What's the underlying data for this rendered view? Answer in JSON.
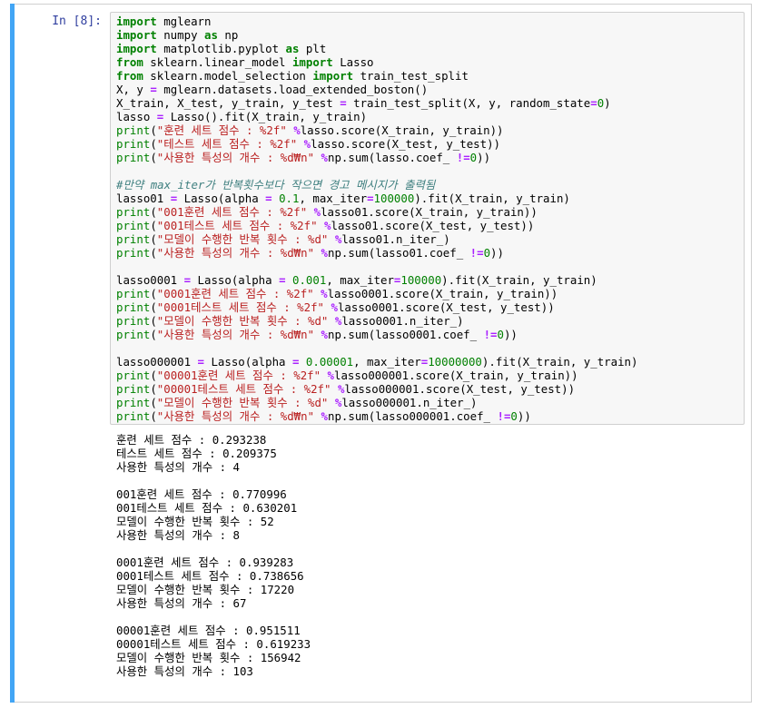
{
  "cell": {
    "prompt": "In [8]:",
    "code_lines": [
      [
        [
          "kw",
          "import"
        ],
        [
          "t",
          " mglearn"
        ]
      ],
      [
        [
          "kw",
          "import"
        ],
        [
          "t",
          " numpy "
        ],
        [
          "kw",
          "as"
        ],
        [
          "t",
          " np"
        ]
      ],
      [
        [
          "kw",
          "import"
        ],
        [
          "t",
          " matplotlib.pyplot "
        ],
        [
          "kw",
          "as"
        ],
        [
          "t",
          " plt"
        ]
      ],
      [
        [
          "kw",
          "from"
        ],
        [
          "t",
          " sklearn.linear_model "
        ],
        [
          "kw",
          "import"
        ],
        [
          "t",
          " Lasso"
        ]
      ],
      [
        [
          "kw",
          "from"
        ],
        [
          "t",
          " sklearn.model_selection "
        ],
        [
          "kw",
          "import"
        ],
        [
          "t",
          " train_test_split"
        ]
      ],
      [
        [
          "t",
          "X, y "
        ],
        [
          "op",
          "="
        ],
        [
          "t",
          " mglearn.datasets.load_extended_boston()"
        ]
      ],
      [
        [
          "t",
          "X_train, X_test, y_train, y_test "
        ],
        [
          "op",
          "="
        ],
        [
          "t",
          " train_test_split(X, y, random_state"
        ],
        [
          "op",
          "="
        ],
        [
          "num",
          "0"
        ],
        [
          "t",
          ")"
        ]
      ],
      [
        [
          "t",
          "lasso "
        ],
        [
          "op",
          "="
        ],
        [
          "t",
          " Lasso().fit(X_train, y_train)"
        ]
      ],
      [
        [
          "bi",
          "print"
        ],
        [
          "t",
          "("
        ],
        [
          "str",
          "\"훈련 세트 점수 : %2f\""
        ],
        [
          "t",
          " "
        ],
        [
          "op",
          "%"
        ],
        [
          "t",
          "lasso.score(X_train, y_train))"
        ]
      ],
      [
        [
          "bi",
          "print"
        ],
        [
          "t",
          "("
        ],
        [
          "str",
          "\"테스트 세트 점수 : %2f\""
        ],
        [
          "t",
          " "
        ],
        [
          "op",
          "%"
        ],
        [
          "t",
          "lasso.score(X_test, y_test))"
        ]
      ],
      [
        [
          "bi",
          "print"
        ],
        [
          "t",
          "("
        ],
        [
          "str",
          "\"사용한 특성의 개수 : %d₩n\""
        ],
        [
          "t",
          " "
        ],
        [
          "op",
          "%"
        ],
        [
          "t",
          "np.sum(lasso.coef_ "
        ],
        [
          "op",
          "!="
        ],
        [
          "num",
          "0"
        ],
        [
          "t",
          "))"
        ]
      ],
      [],
      [
        [
          "cm",
          "#만약 max_iter가 반복횟수보다 작으면 경고 메시지가 출력됨"
        ]
      ],
      [
        [
          "t",
          "lasso01 "
        ],
        [
          "op",
          "="
        ],
        [
          "t",
          " Lasso(alpha "
        ],
        [
          "op",
          "="
        ],
        [
          "t",
          " "
        ],
        [
          "num",
          "0.1"
        ],
        [
          "t",
          ", max_iter"
        ],
        [
          "op",
          "="
        ],
        [
          "num",
          "100000"
        ],
        [
          "t",
          ").fit(X_train, y_train)"
        ]
      ],
      [
        [
          "bi",
          "print"
        ],
        [
          "t",
          "("
        ],
        [
          "str",
          "\"001훈련 세트 점수 : %2f\""
        ],
        [
          "t",
          " "
        ],
        [
          "op",
          "%"
        ],
        [
          "t",
          "lasso01.score(X_train, y_train))"
        ]
      ],
      [
        [
          "bi",
          "print"
        ],
        [
          "t",
          "("
        ],
        [
          "str",
          "\"001테스트 세트 점수 : %2f\""
        ],
        [
          "t",
          " "
        ],
        [
          "op",
          "%"
        ],
        [
          "t",
          "lasso01.score(X_test, y_test))"
        ]
      ],
      [
        [
          "bi",
          "print"
        ],
        [
          "t",
          "("
        ],
        [
          "str",
          "\"모델이 수행한 반복 횟수 : %d\""
        ],
        [
          "t",
          " "
        ],
        [
          "op",
          "%"
        ],
        [
          "t",
          "lasso01.n_iter_)"
        ]
      ],
      [
        [
          "bi",
          "print"
        ],
        [
          "t",
          "("
        ],
        [
          "str",
          "\"사용한 특성의 개수 : %d₩n\""
        ],
        [
          "t",
          " "
        ],
        [
          "op",
          "%"
        ],
        [
          "t",
          "np.sum(lasso01.coef_ "
        ],
        [
          "op",
          "!="
        ],
        [
          "num",
          "0"
        ],
        [
          "t",
          "))"
        ]
      ],
      [],
      [
        [
          "t",
          "lasso0001 "
        ],
        [
          "op",
          "="
        ],
        [
          "t",
          " Lasso(alpha "
        ],
        [
          "op",
          "="
        ],
        [
          "t",
          " "
        ],
        [
          "num",
          "0.001"
        ],
        [
          "t",
          ", max_iter"
        ],
        [
          "op",
          "="
        ],
        [
          "num",
          "100000"
        ],
        [
          "t",
          ").fit(X_train, y_train)"
        ]
      ],
      [
        [
          "bi",
          "print"
        ],
        [
          "t",
          "("
        ],
        [
          "str",
          "\"0001훈련 세트 점수 : %2f\""
        ],
        [
          "t",
          " "
        ],
        [
          "op",
          "%"
        ],
        [
          "t",
          "lasso0001.score(X_train, y_train))"
        ]
      ],
      [
        [
          "bi",
          "print"
        ],
        [
          "t",
          "("
        ],
        [
          "str",
          "\"0001테스트 세트 점수 : %2f\""
        ],
        [
          "t",
          " "
        ],
        [
          "op",
          "%"
        ],
        [
          "t",
          "lasso0001.score(X_test, y_test))"
        ]
      ],
      [
        [
          "bi",
          "print"
        ],
        [
          "t",
          "("
        ],
        [
          "str",
          "\"모델이 수행한 반복 횟수 : %d\""
        ],
        [
          "t",
          " "
        ],
        [
          "op",
          "%"
        ],
        [
          "t",
          "lasso0001.n_iter_)"
        ]
      ],
      [
        [
          "bi",
          "print"
        ],
        [
          "t",
          "("
        ],
        [
          "str",
          "\"사용한 특성의 개수 : %d₩n\""
        ],
        [
          "t",
          " "
        ],
        [
          "op",
          "%"
        ],
        [
          "t",
          "np.sum(lasso0001.coef_ "
        ],
        [
          "op",
          "!="
        ],
        [
          "num",
          "0"
        ],
        [
          "t",
          "))"
        ]
      ],
      [],
      [
        [
          "t",
          "lasso000001 "
        ],
        [
          "op",
          "="
        ],
        [
          "t",
          " Lasso(alpha "
        ],
        [
          "op",
          "="
        ],
        [
          "t",
          " "
        ],
        [
          "num",
          "0.00001"
        ],
        [
          "t",
          ", max_iter"
        ],
        [
          "op",
          "="
        ],
        [
          "num",
          "10000000"
        ],
        [
          "t",
          ").fit(X_train, y_train)"
        ]
      ],
      [
        [
          "bi",
          "print"
        ],
        [
          "t",
          "("
        ],
        [
          "str",
          "\"00001훈련 세트 점수 : %2f\""
        ],
        [
          "t",
          " "
        ],
        [
          "op",
          "%"
        ],
        [
          "t",
          "lasso000001.score(X_train, y_train))"
        ]
      ],
      [
        [
          "bi",
          "print"
        ],
        [
          "t",
          "("
        ],
        [
          "str",
          "\"00001테스트 세트 점수 : %2f\""
        ],
        [
          "t",
          " "
        ],
        [
          "op",
          "%"
        ],
        [
          "t",
          "lasso000001.score(X_test, y_test))"
        ]
      ],
      [
        [
          "bi",
          "print"
        ],
        [
          "t",
          "("
        ],
        [
          "str",
          "\"모델이 수행한 반복 횟수 : %d\""
        ],
        [
          "t",
          " "
        ],
        [
          "op",
          "%"
        ],
        [
          "t",
          "lasso000001.n_iter_)"
        ]
      ],
      [
        [
          "bi",
          "print"
        ],
        [
          "t",
          "("
        ],
        [
          "str",
          "\"사용한 특성의 개수 : %d₩n\""
        ],
        [
          "t",
          " "
        ],
        [
          "op",
          "%"
        ],
        [
          "t",
          "np.sum(lasso000001.coef_ "
        ],
        [
          "op",
          "!="
        ],
        [
          "num",
          "0"
        ],
        [
          "t",
          "))"
        ]
      ]
    ],
    "output_lines": [
      "훈련 세트 점수 : 0.293238",
      "테스트 세트 점수 : 0.209375",
      "사용한 특성의 개수 : 4",
      "",
      "001훈련 세트 점수 : 0.770996",
      "001테스트 세트 점수 : 0.630201",
      "모델이 수행한 반복 횟수 : 52",
      "사용한 특성의 개수 : 8",
      "",
      "0001훈련 세트 점수 : 0.939283",
      "0001테스트 세트 점수 : 0.738656",
      "모델이 수행한 반복 횟수 : 17220",
      "사용한 특성의 개수 : 67",
      "",
      "00001훈련 세트 점수 : 0.951511",
      "00001테스트 세트 점수 : 0.619233",
      "모델이 수행한 반복 횟수 : 156942",
      "사용한 특성의 개수 : 103"
    ]
  },
  "colors": {
    "selected_bar": "#42a5f5",
    "prompt": "#303f9f",
    "keyword": "#008000",
    "string": "#ba2121",
    "operator": "#aa22ff",
    "comment": "#408080"
  }
}
